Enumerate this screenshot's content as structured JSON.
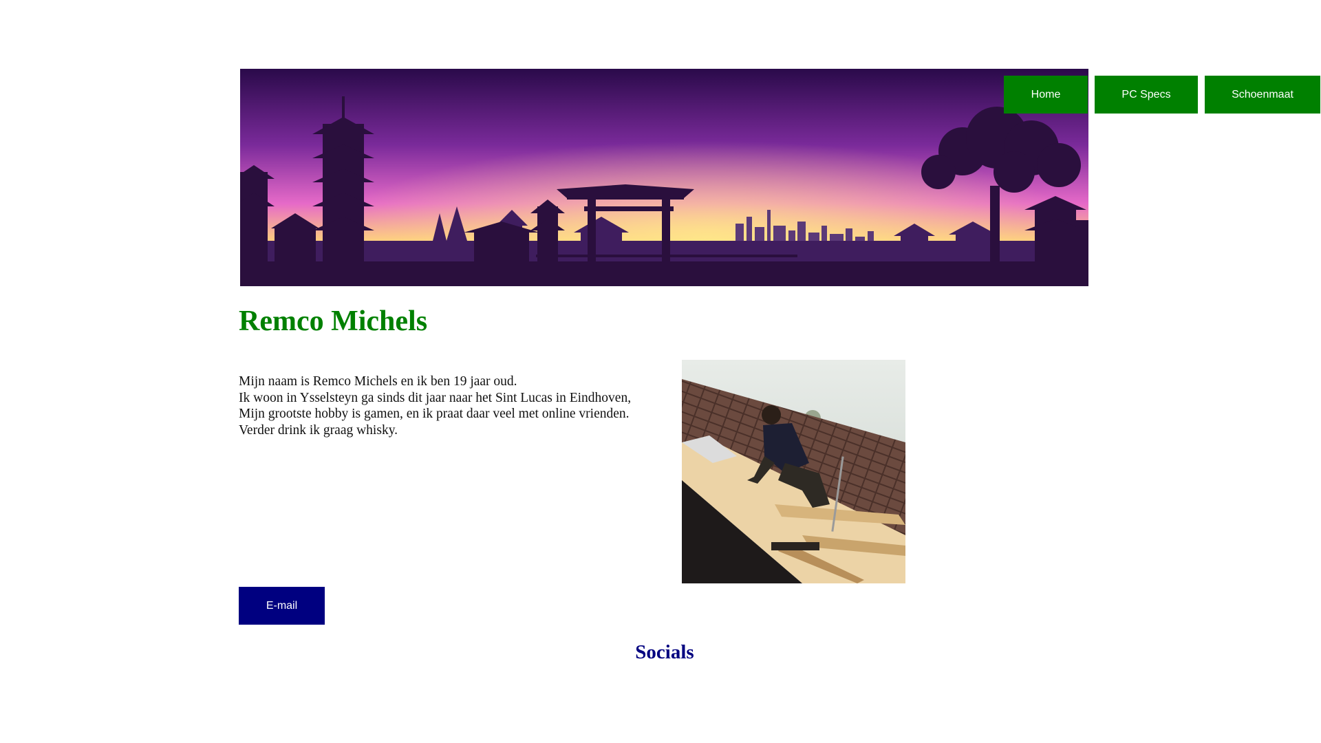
{
  "nav": {
    "items": [
      {
        "label": "Home"
      },
      {
        "label": "PC Specs"
      },
      {
        "label": "Schoenmaat"
      }
    ],
    "color": "#008000"
  },
  "banner": {
    "icon": "asian-skyline-sunset-illustration"
  },
  "main": {
    "title": "Remco Michels",
    "title_color": "#008000",
    "intro_lines": [
      "Mijn naam is Remco Michels en ik ben 19 jaar oud.",
      "Ik woon in Ysselsteyn ga sinds dit jaar naar het Sint Lucas in Eindhoven,",
      "Mijn grootste hobby is gamen, en ik praat daar veel met online vrienden.",
      "Verder drink ik graag whisky."
    ],
    "photo": {
      "icon": "person-on-roof-photo"
    },
    "email_label": "E-mail",
    "email_color": "#000080"
  },
  "socials": {
    "heading": "Socials",
    "color": "#000080"
  }
}
